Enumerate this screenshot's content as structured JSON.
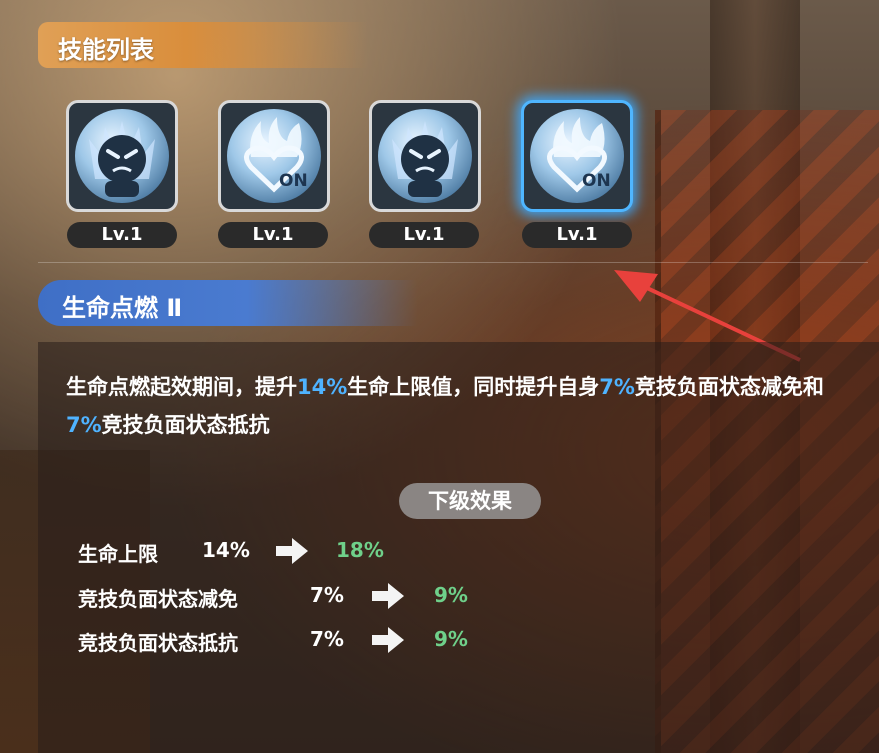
{
  "header": {
    "title": "技能列表"
  },
  "skills": [
    {
      "name": "angry-skill",
      "level": "Lv.1",
      "on_label": "",
      "selected": false
    },
    {
      "name": "heart-flame-skill",
      "level": "Lv.1",
      "on_label": "ON",
      "selected": false
    },
    {
      "name": "angry-skill",
      "level": "Lv.1",
      "on_label": "",
      "selected": false
    },
    {
      "name": "heart-flame-skill",
      "level": "Lv.1",
      "on_label": "ON",
      "selected": true
    }
  ],
  "detail": {
    "title": "生命点燃 Ⅱ",
    "desc_parts": {
      "p1": "生命点燃起效期间，提升",
      "v1": "14%",
      "p2": "生命上限值，同时提升自身",
      "v2": "7%",
      "p3": "竞技负面状态减免和",
      "v3": "7%",
      "p4": "竞技负面状态抵抗"
    },
    "next_label": "下级效果",
    "rows": [
      {
        "name": "生命上限",
        "current": "14%",
        "next": "18%"
      },
      {
        "name": "竞技负面状态减免",
        "current": "7%",
        "next": "9%"
      },
      {
        "name": "竞技负面状态抵抗",
        "current": "7%",
        "next": "9%"
      }
    ]
  },
  "colors": {
    "header_bar": "#d98e3c",
    "title_bar": "#4a7bd0",
    "highlight": "#4fb3ff",
    "next_value": "#6fd08a",
    "selected_glow": "#4fb6ff",
    "pointer_arrow": "#e8413c"
  }
}
